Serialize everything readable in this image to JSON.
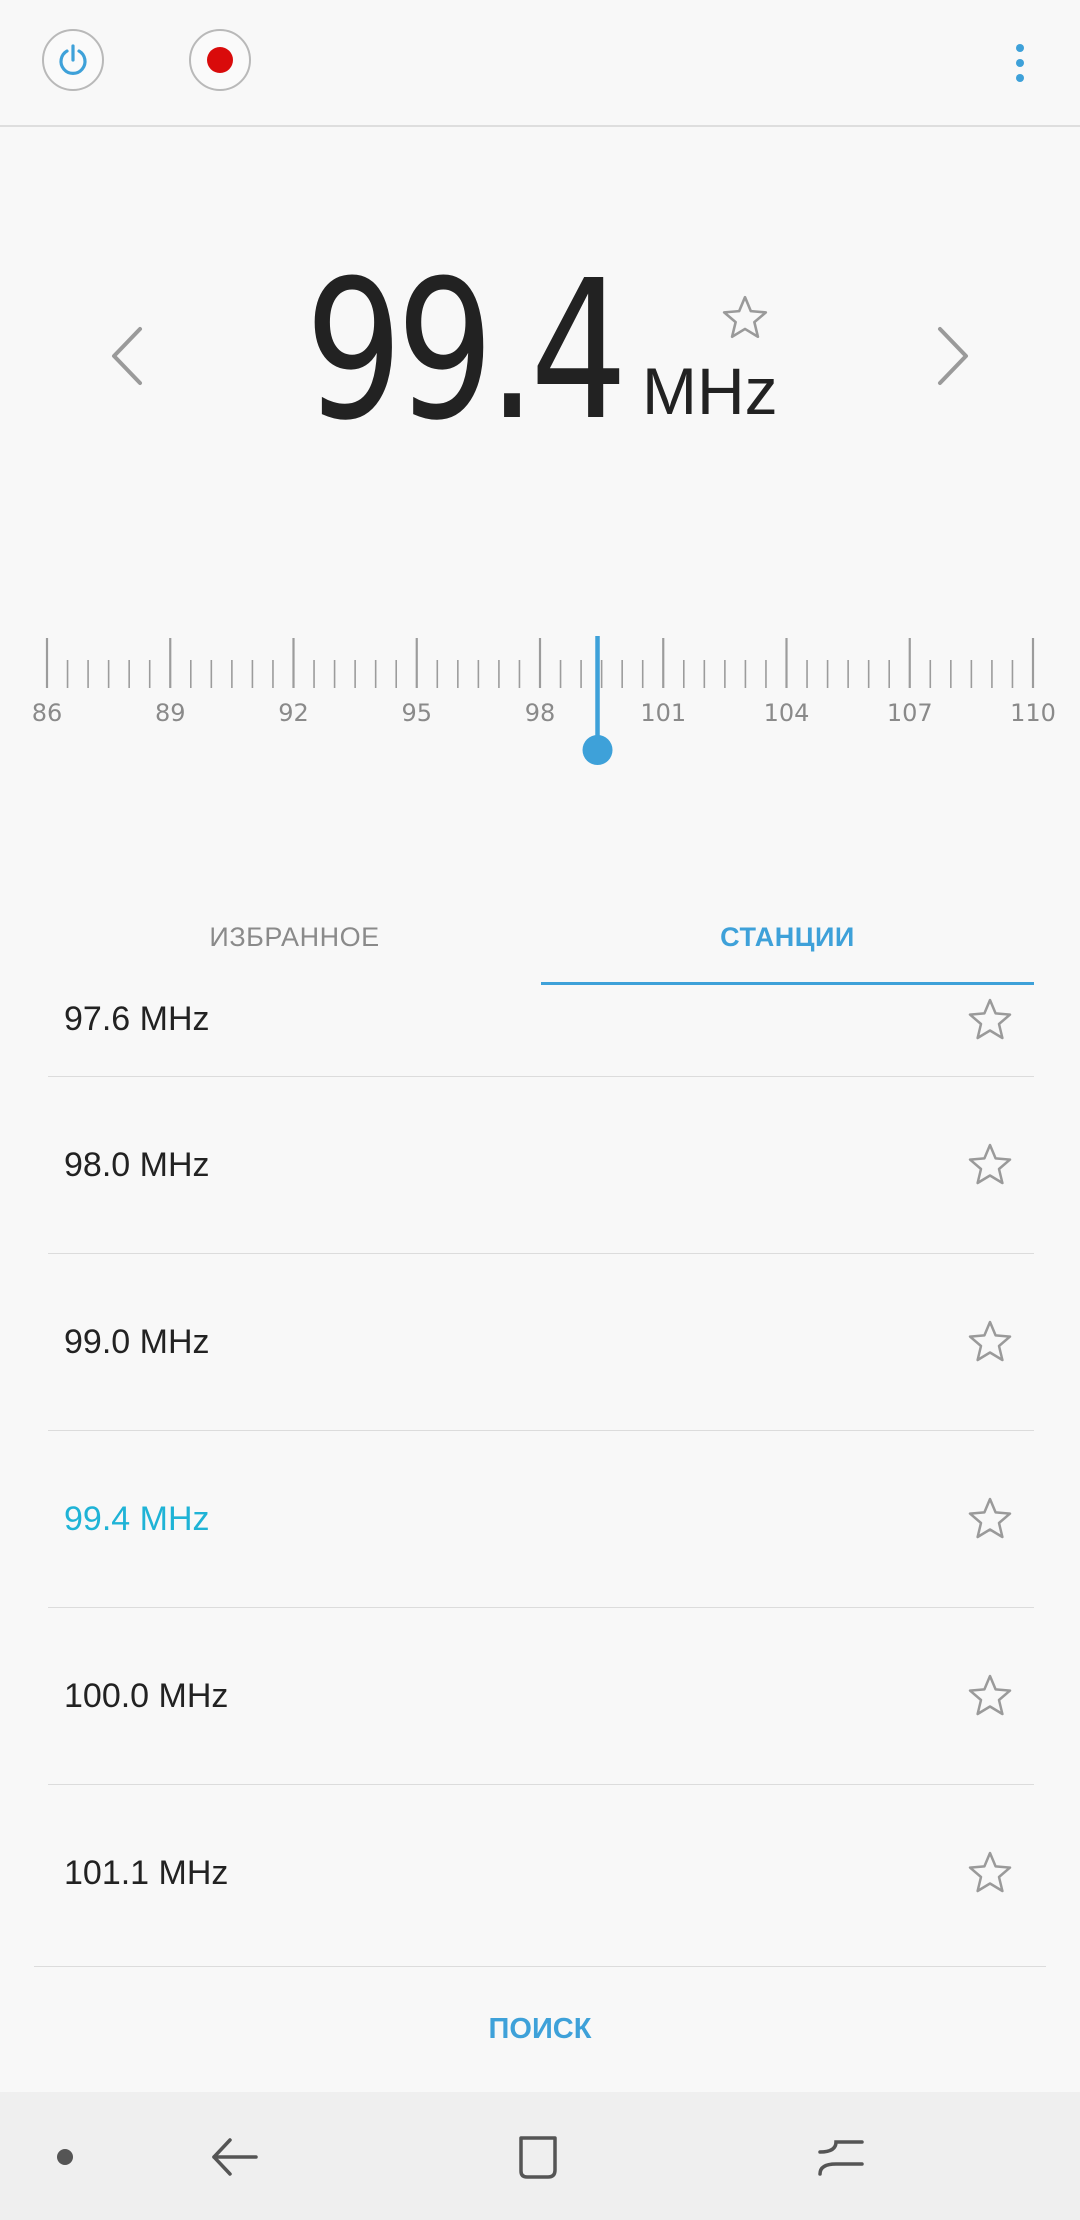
{
  "tuner": {
    "frequency": "99.4",
    "unit": "MHz"
  },
  "dial": {
    "labels": [
      "86",
      "89",
      "92",
      "95",
      "98",
      "101",
      "104",
      "107",
      "110"
    ],
    "current": 99.4
  },
  "tabs": [
    {
      "label": "ИЗБРАННОЕ",
      "active": false
    },
    {
      "label": "СТАНЦИИ",
      "active": true
    }
  ],
  "stations": [
    {
      "label": "97.6 MHz",
      "active": false
    },
    {
      "label": "98.0 MHz",
      "active": false
    },
    {
      "label": "99.0 MHz",
      "active": false
    },
    {
      "label": "99.4 MHz",
      "active": true
    },
    {
      "label": "100.0 MHz",
      "active": false
    },
    {
      "label": "101.1 MHz",
      "active": false
    }
  ],
  "search_label": "ПОИСК",
  "colors": {
    "accent": "#3ea1d9",
    "active_station": "#1fb3d6",
    "record": "#d90b0b"
  },
  "icons": {
    "power": "power-icon",
    "record": "record-icon",
    "more": "more-vertical-icon",
    "prev": "chevron-left-icon",
    "next": "chevron-right-icon",
    "favorite": "star-outline-icon"
  }
}
